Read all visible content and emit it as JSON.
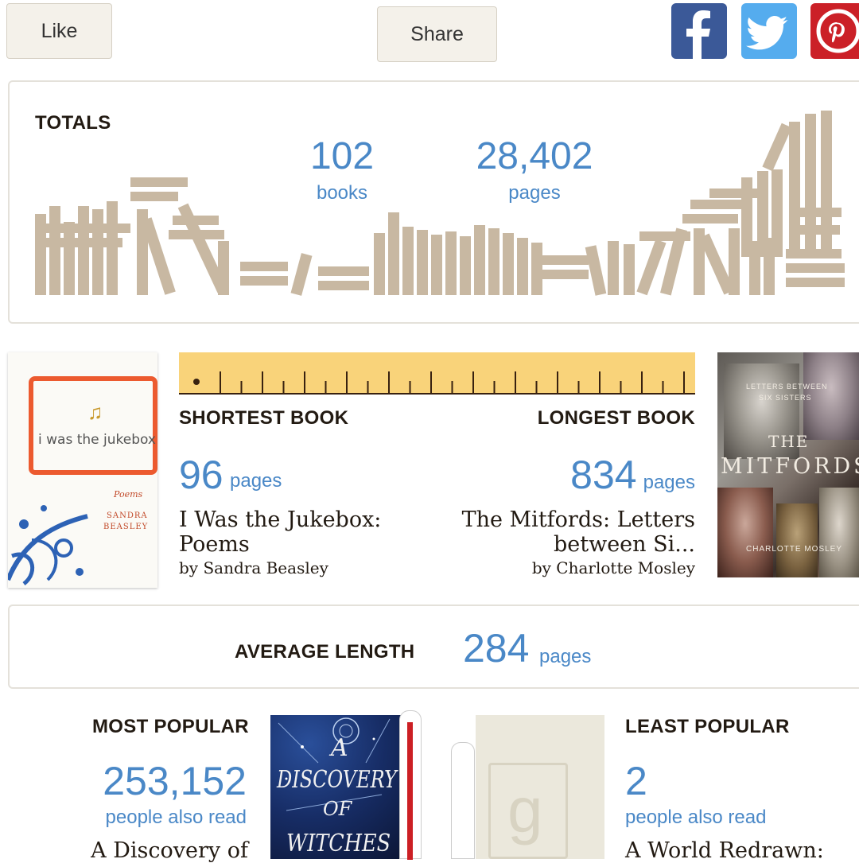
{
  "actions": {
    "like_label": "Like",
    "share_label": "Share"
  },
  "social": {
    "facebook_icon": "facebook-icon",
    "twitter_icon": "twitter-icon",
    "pinterest_icon": "pinterest-icon"
  },
  "colors": {
    "accent": "#4a88c7",
    "book": "#c8b8a2",
    "ruler": "#f9d37a",
    "facebook": "#3b5998",
    "twitter": "#55acee",
    "pinterest": "#cb2027"
  },
  "totals": {
    "heading": "TOTALS",
    "books_value": "102",
    "books_label": "books",
    "pages_value": "28,402",
    "pages_label": "pages"
  },
  "shortest": {
    "heading": "SHORTEST BOOK",
    "pages_value": "96",
    "pages_label": "pages",
    "title": "I Was the Jukebox: Poems",
    "author": "by Sandra Beasley",
    "cover": {
      "title": "i was the jukebox",
      "subtitle": "Poems",
      "author_line1": "SANDRA",
      "author_line2": "BEASLEY"
    }
  },
  "longest": {
    "heading": "LONGEST BOOK",
    "pages_value": "834",
    "pages_label": "pages",
    "title_line1": "The Mitfords: Letters",
    "title_line2": "between Si...",
    "author": "by Charlotte Mosley",
    "cover": {
      "top_line1": "LETTERS BETWEEN",
      "top_line2": "SIX SISTERS",
      "the": "THE",
      "title": "MITFORDS",
      "bottom": "CHARLOTTE MOSLEY"
    }
  },
  "average": {
    "heading": "AVERAGE LENGTH",
    "pages_value": "284",
    "pages_label": "pages"
  },
  "most_popular": {
    "heading": "MOST POPULAR",
    "count": "253,152",
    "count_label": "people also read",
    "title": "A Discovery of",
    "cover": {
      "line1": "A",
      "line2": "DISCOVERY",
      "line3": "OF",
      "line4": "WITCHES"
    }
  },
  "least_popular": {
    "heading": "LEAST POPULAR",
    "count": "2",
    "count_label": "people also read",
    "title": "A World Redrawn:",
    "cover": {
      "placeholder_letter": "g"
    }
  }
}
